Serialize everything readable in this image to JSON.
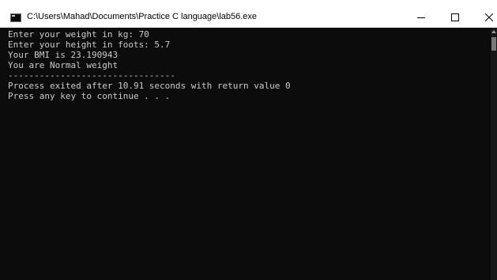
{
  "window": {
    "title": "C:\\Users\\Mahad\\Documents\\Practice C language\\lab56.exe"
  },
  "console": {
    "lines": [
      "Enter your weight in kg: 70",
      "Enter your height in foots: 5.7",
      "Your BMI is 23.190943",
      "You are Normal weight",
      "--------------------------------",
      "Process exited after 10.91 seconds with return value 0",
      "Press any key to continue . . ."
    ]
  },
  "colors": {
    "console_background": "#0c0c0c",
    "console_text": "#cccccc",
    "titlebar_background": "#ffffff"
  },
  "icons": {
    "app": "console-app-icon",
    "minimize": "minimize-icon",
    "maximize": "maximize-icon",
    "close": "close-icon"
  }
}
